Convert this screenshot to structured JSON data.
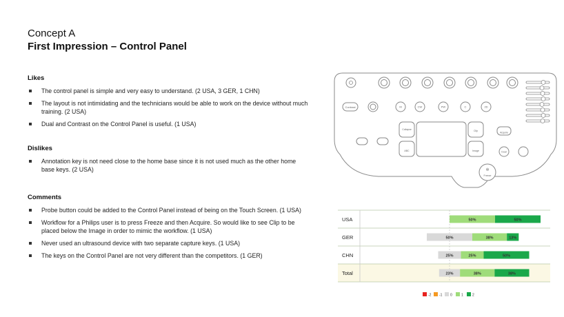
{
  "title": {
    "line1": "Concept A",
    "line2": "First Impression – Control Panel"
  },
  "likes": {
    "heading": "Likes",
    "items": [
      "The control panel is simple and very easy to understand. (2 USA, 3 GER, 1 CHN)",
      "The layout is not intimidating and the technicians would be able to work on the device without much training. (2 USA)",
      "Dual and Contrast on the Control Panel is useful. (1 USA)"
    ]
  },
  "dislikes": {
    "heading": "Dislikes",
    "items": [
      "Annotation key is not need close to the home base since it is not used much as the other home base keys. (2 USA)"
    ]
  },
  "comments": {
    "heading": "Comments",
    "items": [
      "Probe button could be added to the Control Panel instead of being on the Touch Screen. (1 USA)",
      "Workflow for a Philips user is to press Freeze and then Acquire. So would like to see Clip to be placed below the Image in order to mimic the workflow. (1 USA)",
      "Never used an ultrasound device with two separate capture keys. (1 USA)",
      "The keys on the Control Panel are not very different than the competitors. (1 GER)"
    ]
  },
  "panel_labels": {
    "contrast": "Contrast",
    "collapse": "Collapse",
    "clip": "Clip",
    "image": "Image",
    "abc": "ABC",
    "acquire": "Acquire",
    "dual": "Dual",
    "freeze": "Freeze",
    "c": "C",
    "cw": "CW",
    "pw": "PW",
    "tgc": "2D"
  },
  "chart_data": {
    "type": "bar",
    "stacked": true,
    "orientation": "horizontal",
    "categories": [
      "USA",
      "GER",
      "CHN",
      "Total"
    ],
    "series": [
      {
        "name": "-2",
        "color": "#e8231f",
        "values": [
          0,
          0,
          0,
          0
        ]
      },
      {
        "name": "-1",
        "color": "#f59a22",
        "values": [
          0,
          0,
          0,
          0
        ]
      },
      {
        "name": "0",
        "color": "#d9d9d9",
        "values": [
          0,
          50,
          25,
          23
        ]
      },
      {
        "name": "1",
        "color": "#9fdc7a",
        "values": [
          50,
          38,
          25,
          38
        ]
      },
      {
        "name": "2",
        "color": "#1aa84a",
        "values": [
          50,
          13,
          50,
          38
        ]
      }
    ],
    "labels": [
      [
        "",
        "",
        "",
        "50%",
        "50%"
      ],
      [
        "",
        "",
        "50%",
        "38%",
        "13%"
      ],
      [
        "",
        "",
        "25%",
        "25%",
        "50%"
      ],
      [
        "",
        "",
        "23%",
        "38%",
        "38%"
      ]
    ],
    "zero_point": "middle of neutral segment",
    "legend_position": "bottom",
    "highlight_row": "Total",
    "highlight_color": "#fbf8e4"
  }
}
